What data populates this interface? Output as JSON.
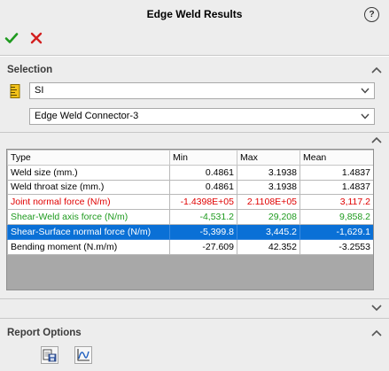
{
  "window": {
    "title": "Edge Weld Results",
    "help_label": "?"
  },
  "selection": {
    "heading": "Selection",
    "units_value": "SI",
    "connector_value": "Edge Weld Connector-3"
  },
  "results_table": {
    "columns": [
      "Type",
      "Min",
      "Max",
      "Mean"
    ],
    "rows": [
      {
        "type": "Weld size (mm.)",
        "min": "0.4861",
        "max": "3.1938",
        "mean": "1.4837",
        "style": "normal"
      },
      {
        "type": "Weld throat size (mm.)",
        "min": "0.4861",
        "max": "3.1938",
        "mean": "1.4837",
        "style": "normal"
      },
      {
        "type": "Joint normal force (N/m)",
        "min": "-1.4398E+05",
        "max": "2.1108E+05",
        "mean": "3,117.2",
        "style": "red"
      },
      {
        "type": "Shear-Weld axis force (N/m)",
        "min": "-4,531.2",
        "max": "29,208",
        "mean": "9,858.2",
        "style": "green"
      },
      {
        "type": "Shear-Surface normal force (N/m)",
        "min": "-5,399.8",
        "max": "3,445.2",
        "mean": "-1,629.1",
        "style": "selected"
      },
      {
        "type": "Bending moment (N.m/m)",
        "min": "-27.609",
        "max": "42.352",
        "mean": "-3.2553",
        "style": "normal"
      }
    ]
  },
  "report_options": {
    "heading": "Report Options"
  },
  "icons": {
    "ok": "checkmark-icon",
    "cancel": "close-icon",
    "units": "ruler-icon",
    "save_report": "save-report-icon",
    "plot": "plot-icon"
  },
  "colors": {
    "ok": "#1e9a1e",
    "cancel": "#d32020",
    "selected_row": "#0a70d6",
    "red_text": "#e00000",
    "green_text": "#1e9a1e"
  }
}
